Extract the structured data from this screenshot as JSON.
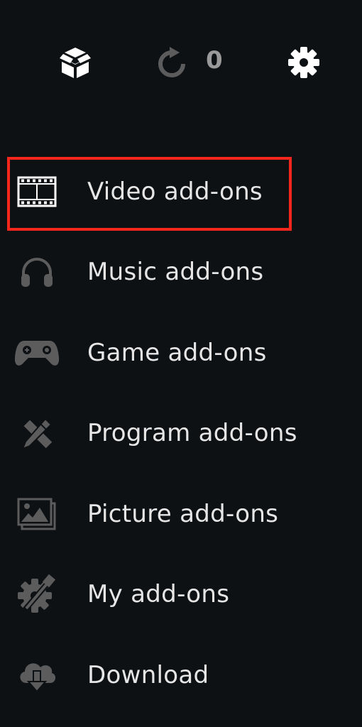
{
  "topbar": {
    "install_icon": "open-box-icon",
    "update_icon": "refresh-icon",
    "update_count": "0",
    "settings_icon": "gear-icon"
  },
  "menu": {
    "items": [
      {
        "label": "Video add-ons",
        "icon": "film-strip-icon",
        "selected": true
      },
      {
        "label": "Music add-ons",
        "icon": "headphones-icon"
      },
      {
        "label": "Game add-ons",
        "icon": "gamepad-icon"
      },
      {
        "label": "Program add-ons",
        "icon": "pencil-ruler-icon"
      },
      {
        "label": "Picture add-ons",
        "icon": "picture-icon"
      },
      {
        "label": "My add-ons",
        "icon": "gear-wrench-icon"
      },
      {
        "label": "Download",
        "icon": "cloud-download-icon"
      }
    ]
  },
  "colors": {
    "background": "#0e1114",
    "highlight_border": "#f5261c",
    "text": "#e6e6e6",
    "icon_inactive": "#5c5c5c",
    "icon_active": "#ffffff"
  }
}
